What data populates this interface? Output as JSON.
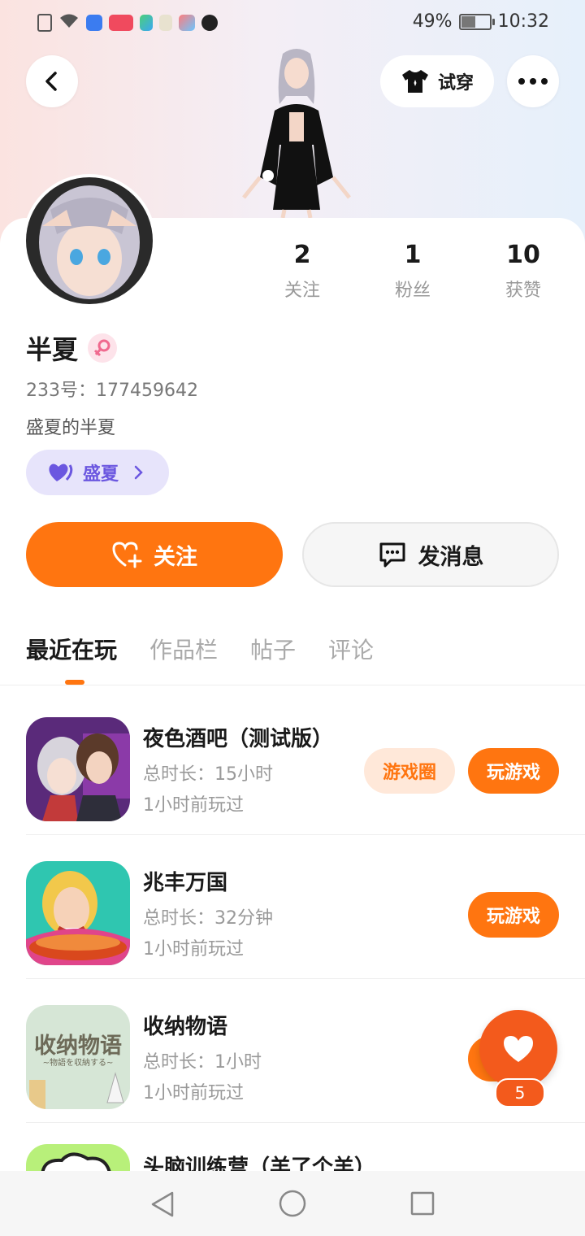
{
  "status_bar": {
    "battery": "49%",
    "battery_fraction": 0.49,
    "time": "10:32"
  },
  "header": {
    "try_on_label": "试穿"
  },
  "profile": {
    "name": "半夏",
    "id_label": "233号：",
    "id_value": "177459642",
    "bio": "盛夏的半夏",
    "tag": "盛夏",
    "stats": [
      {
        "num": "2",
        "label": "关注"
      },
      {
        "num": "1",
        "label": "粉丝"
      },
      {
        "num": "10",
        "label": "获赞"
      }
    ]
  },
  "actions": {
    "follow": "关注",
    "message": "发消息"
  },
  "tabs": [
    "最近在玩",
    "作品栏",
    "帖子",
    "评论"
  ],
  "games": [
    {
      "title": "夜色酒吧（测试版）",
      "duration": "总时长：15小时",
      "last_played": "1小时前玩过",
      "circle_label": "游戏圈",
      "play_label": "玩游戏"
    },
    {
      "title": "兆丰万国",
      "duration": "总时长：32分钟",
      "last_played": "1小时前玩过",
      "play_label": "玩游戏"
    },
    {
      "title": "收纳物语",
      "duration": "总时长：1小时",
      "last_played": "1小时前玩过",
      "icon_text": "收纳物语",
      "icon_sub": "~物語を収納する~"
    },
    {
      "title": "头脑训练营（羊了个羊）"
    }
  ],
  "float_like": {
    "count": "5"
  }
}
